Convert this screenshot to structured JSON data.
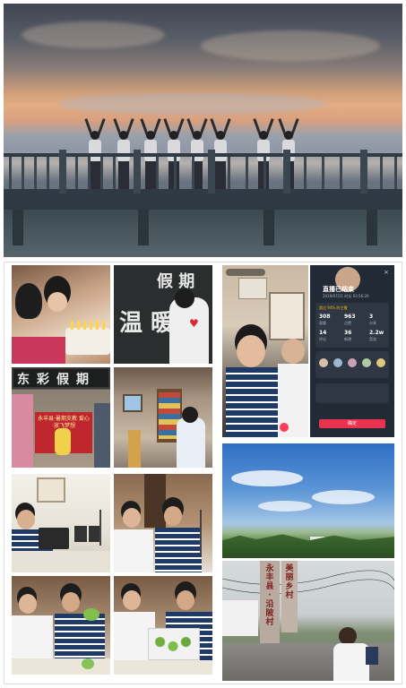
{
  "banner_text": {
    "line1": "东",
    "line2": "彩",
    "line3": "假",
    "line4": "期"
  },
  "blackboard": {
    "chars_top": "假 期",
    "chars_bottom": "温 暖"
  },
  "red_banner": "永丰县·暑期支教 爱心·放飞梦想",
  "live_stream": {
    "title": "直播已结束",
    "subtitle": "2019/07/21 时长 03:56:20",
    "stats": [
      {
        "num": "308",
        "label": "观看"
      },
      {
        "num": "963",
        "label": "点赞"
      },
      {
        "num": "3",
        "label": "分享"
      },
      {
        "num": "14",
        "label": "评论"
      },
      {
        "num": "36",
        "label": "新增"
      },
      {
        "num": "2.2w",
        "label": "音浪"
      }
    ],
    "note": "超过 94% 的主播",
    "button": "确定"
  },
  "monument": {
    "left_stone": "永丰县·沿陂村",
    "right_stone": "美丽乡村"
  },
  "colors": {
    "sunset_orange": "#e4ad82",
    "shirt_blue": "#1f3a66",
    "banner_red": "#c0262e"
  }
}
